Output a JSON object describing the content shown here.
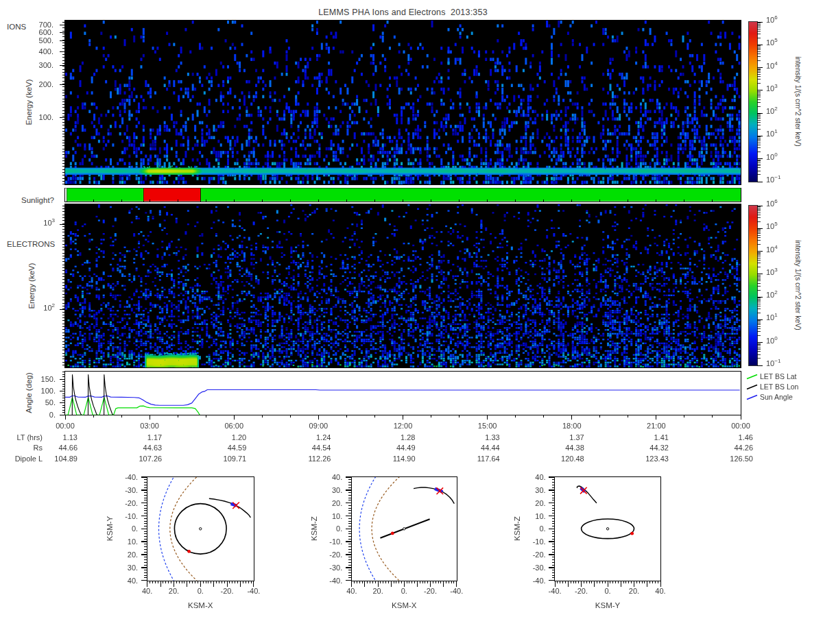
{
  "title": "LEMMS PHA Ions and Electrons  2013:353",
  "text_color": "#3c3c3c",
  "chart_data": {
    "ions": {
      "type": "heatmap",
      "label": "IONS",
      "ylabel": "Energy (keV)",
      "yscale": "log",
      "yrange_kev": [
        24.5,
        768
      ],
      "ytick_labels": [
        "700.",
        "600.",
        "500.",
        "400.",
        "300.",
        "200.",
        "100."
      ],
      "ytick_values": [
        700,
        600,
        500,
        400,
        300,
        200,
        100
      ],
      "xrange_hours": [
        0,
        24
      ],
      "background": "#000000",
      "noise": {
        "seed": 11,
        "description": "sparse blue speckle noise, density increasing toward low energy",
        "speckle_log_intensity": [
          0.2,
          1.8
        ]
      },
      "band": {
        "description": "persistent low-energy proton band",
        "energy_kev": [
          34,
          46
        ],
        "log_intensity": 0.9,
        "bright_interval_hr": [
          2.6,
          4.87
        ],
        "bright_log_intensity": 3.0
      }
    },
    "sunlight": {
      "type": "timeline",
      "label": "Sunlight?",
      "segments": [
        {
          "start_hr": 0.0,
          "end_hr": 0.06,
          "state": "no data",
          "color": "#ffffff"
        },
        {
          "start_hr": 0.06,
          "end_hr": 2.79,
          "state": "yes",
          "color": "#00e000"
        },
        {
          "start_hr": 2.79,
          "end_hr": 4.82,
          "state": "no",
          "color": "#ee0000"
        },
        {
          "start_hr": 4.82,
          "end_hr": 24.0,
          "state": "yes",
          "color": "#00e000"
        }
      ]
    },
    "electrons": {
      "type": "heatmap",
      "label": "ELECTRONS",
      "ylabel": "Energy (keV)",
      "yscale": "log",
      "yrange_kev": [
        21,
        1745
      ],
      "ytick_exponents": [
        3,
        2
      ],
      "xrange_hours": [
        0,
        24
      ],
      "background": "#000000",
      "noise": {
        "seed": 23,
        "description": "blue speckle noise, very sparse at high energy, dense with cyan/green mix at low energy",
        "speckle_log_intensity": [
          0.2,
          1.6
        ]
      },
      "blob": {
        "description": "bright low-energy electron enhancement during eclipse",
        "time_hr": [
          2.83,
          4.73
        ],
        "energy_kev": [
          18,
          27
        ],
        "core_log_intensity": 3.4
      }
    },
    "colorbar": {
      "label": "intensity 1/(s cm^2 ster keV)",
      "log_range": [
        -1,
        6
      ],
      "tick_exponents": [
        6,
        5,
        4,
        3,
        2,
        1,
        0,
        -1
      ]
    },
    "angles": {
      "type": "line",
      "ylabel": "Angle (deg)",
      "ytick_labels": [
        "150.",
        "100.",
        "50.",
        "0."
      ],
      "ytick_values": [
        150,
        100,
        50,
        0
      ],
      "yrange_deg": [
        0,
        184
      ],
      "xrange_hours": [
        0,
        24
      ],
      "legend": [
        {
          "label": "LET BS Lat",
          "color": "#00dd00"
        },
        {
          "label": "LET BS Lon",
          "color": "#000000"
        },
        {
          "label": "Sun Angle",
          "color": "#2222ee"
        }
      ],
      "series": {
        "sun_angle": [
          [
            0,
            74.5
          ],
          [
            0.16,
            74.5
          ],
          [
            0.24,
            80
          ],
          [
            0.34,
            80
          ],
          [
            0.46,
            75
          ],
          [
            0.72,
            74.5
          ],
          [
            0.8,
            79
          ],
          [
            0.92,
            80
          ],
          [
            1.04,
            75.5
          ],
          [
            1.3,
            74.5
          ],
          [
            1.37,
            79
          ],
          [
            1.5,
            80
          ],
          [
            1.62,
            75.5
          ],
          [
            2.0,
            74.5
          ],
          [
            2.45,
            73.5
          ],
          [
            2.62,
            72
          ],
          [
            2.75,
            64
          ],
          [
            2.9,
            53
          ],
          [
            3.05,
            45
          ],
          [
            3.2,
            41.5
          ],
          [
            3.35,
            40.5
          ],
          [
            4.2,
            40.5
          ],
          [
            4.35,
            43
          ],
          [
            4.5,
            50
          ],
          [
            4.62,
            68
          ],
          [
            4.75,
            88
          ],
          [
            4.87,
            97
          ],
          [
            4.95,
            99
          ],
          [
            5.05,
            106
          ],
          [
            8.9,
            106
          ],
          [
            9.05,
            104.5
          ],
          [
            23.97,
            104.5
          ]
        ],
        "let_bs_lat": [
          [
            0,
            0
          ],
          [
            0.1,
            0
          ],
          [
            0.256,
            73
          ],
          [
            0.41,
            0
          ],
          [
            0.66,
            0
          ],
          [
            0.82,
            74
          ],
          [
            0.98,
            0
          ],
          [
            1.22,
            0
          ],
          [
            1.385,
            74
          ],
          [
            1.55,
            0
          ],
          [
            1.72,
            0
          ],
          [
            1.8,
            27
          ],
          [
            1.88,
            30
          ],
          [
            2.55,
            30
          ],
          [
            2.65,
            37
          ],
          [
            2.78,
            38
          ],
          [
            2.92,
            32
          ],
          [
            3.0,
            30.5
          ],
          [
            4.5,
            30
          ],
          [
            4.62,
            27
          ],
          [
            4.72,
            12
          ],
          [
            4.78,
            0
          ]
        ],
        "let_bs_lon_spikes": [
          [
            [
              0.25,
              0
            ],
            [
              0.256,
              169
            ],
            [
              0.29,
              120
            ],
            [
              0.33,
              90
            ],
            [
              0.38,
              62
            ],
            [
              0.44,
              38
            ],
            [
              0.5,
              18
            ],
            [
              0.55,
              5
            ],
            [
              0.58,
              0
            ]
          ],
          [
            [
              0.815,
              0
            ],
            [
              0.82,
              169
            ],
            [
              0.855,
              120
            ],
            [
              0.895,
              90
            ],
            [
              0.945,
              62
            ],
            [
              1.005,
              38
            ],
            [
              1.07,
              18
            ],
            [
              1.11,
              5
            ],
            [
              1.14,
              0
            ]
          ],
          [
            [
              1.38,
              0
            ],
            [
              1.385,
              169
            ],
            [
              1.42,
              120
            ],
            [
              1.46,
              90
            ],
            [
              1.51,
              62
            ],
            [
              1.57,
              38
            ],
            [
              1.63,
              18
            ],
            [
              1.67,
              5
            ],
            [
              1.7,
              0
            ]
          ]
        ]
      }
    },
    "ephemeris": {
      "type": "table",
      "time_tick_labels": [
        "00:00",
        "03:00",
        "06:00",
        "09:00",
        "12:00",
        "15:00",
        "18:00",
        "21:00",
        "00:00"
      ],
      "rows": [
        {
          "label": "LT (hrs)",
          "values": [
            "1.13",
            "1.17",
            "1.20",
            "1.24",
            "1.28",
            "1.33",
            "1.37",
            "1.41",
            "1.46"
          ]
        },
        {
          "label": "Rs",
          "values": [
            "44.66",
            "44.63",
            "44.59",
            "44.54",
            "44.49",
            "44.44",
            "44.38",
            "44.32",
            "44.26"
          ]
        },
        {
          "label": "Dipole L",
          "values": [
            "104.89",
            "107.26",
            "109.71",
            "112.26",
            "114.90",
            "117.64",
            "120.48",
            "123.43",
            "126.50"
          ]
        }
      ]
    },
    "orbits": {
      "xy": {
        "type": "scatter",
        "xlabel": "KSM-X",
        "ylabel": "KSM-Y",
        "xtick_labels": [
          "40.",
          "20.",
          "0.",
          "-20.",
          "-40."
        ],
        "xtick_values": [
          40,
          20,
          0,
          -20,
          -40
        ],
        "ytick_labels": [
          "-40.",
          "-30.",
          "-20.",
          "-10.",
          "0.",
          "10.",
          "20.",
          "30.",
          "40."
        ],
        "ytick_values": [
          -40,
          -30,
          -20,
          -10,
          0,
          10,
          20,
          30,
          40
        ],
        "x_left_value": 40,
        "x_right_value": -40,
        "y_top_value": -40,
        "y_bottom_value": 40,
        "bow_shock": {
          "apex_x": 31.3,
          "coef": 0.007,
          "color": "#2244ee"
        },
        "magnetopause": {
          "apex_x": 22.9,
          "coef": 0.0125,
          "color": "#96591e"
        },
        "titan_orbit_circle": {
          "cx": 0,
          "cy": 0,
          "r": 19.5
        },
        "saturn": {
          "x": 0,
          "y": 0
        },
        "titan_dot": {
          "x": 8.6,
          "y": 17.5,
          "color": "#ee0000"
        },
        "trajectory": [
          [
            -6.5,
            -23.4
          ],
          [
            -10,
            -23.0
          ],
          [
            -14,
            -22.3
          ],
          [
            -18,
            -21.4
          ],
          [
            -22,
            -20.2
          ],
          [
            -26,
            -18.5
          ],
          [
            -29.5,
            -16.5
          ],
          [
            -32.5,
            -14.2
          ],
          [
            -34.8,
            -12.2
          ],
          [
            -36.5,
            -10.5
          ],
          [
            -37.7,
            -8.7
          ]
        ],
        "coverage_segment": [
          [
            -22.9,
            -19.4
          ],
          [
            -27.2,
            -17.9
          ]
        ],
        "position_marker": {
          "x": -26.7,
          "y": -18.1,
          "color": "#ee0000"
        }
      },
      "xz": {
        "type": "scatter",
        "xlabel": "KSM-X",
        "ylabel": "KSM-Z",
        "xtick_labels": [
          "40.",
          "20.",
          "0.",
          "-20.",
          "-40."
        ],
        "xtick_values": [
          40,
          20,
          0,
          -20,
          -40
        ],
        "ytick_labels": [
          "40.",
          "30.",
          "20.",
          "10.",
          "0.",
          "-10.",
          "-20.",
          "-30.",
          "-40."
        ],
        "ytick_values": [
          40,
          30,
          20,
          10,
          0,
          -10,
          -20,
          -30,
          -40
        ],
        "x_left_value": 40,
        "x_right_value": -40,
        "y_top_value": 40,
        "y_bottom_value": -40,
        "bow_shock": {
          "apex_x": 34.1,
          "coef": 0.0076,
          "color": "#2244ee"
        },
        "magnetopause": {
          "apex_x": 24.7,
          "coef": 0.013,
          "color": "#96591e"
        },
        "titan_orbit_line": [
          [
            18.2,
            -7.1
          ],
          [
            -19.5,
            7.5
          ]
        ],
        "saturn": {
          "x": 0,
          "y": 0
        },
        "titan_dot": {
          "x": 8.9,
          "y": -3.5,
          "color": "#ee0000"
        },
        "trajectory": [
          [
            -7.2,
            31.2
          ],
          [
            -10,
            31.7
          ],
          [
            -13,
            32.0
          ],
          [
            -16,
            32.0
          ],
          [
            -19,
            31.7
          ],
          [
            -22,
            31.2
          ],
          [
            -25,
            30.4
          ],
          [
            -27.5,
            29.5
          ],
          [
            -30,
            28.2
          ],
          [
            -32.5,
            26.5
          ],
          [
            -34.7,
            24.5
          ],
          [
            -36.6,
            22.2
          ],
          [
            -38.2,
            19.5
          ]
        ],
        "coverage_segment": [
          [
            -23.4,
            31.0
          ],
          [
            -29.3,
            28.7
          ]
        ],
        "position_marker": {
          "x": -27.2,
          "y": 29.3,
          "color": "#ee0000"
        }
      },
      "yz": {
        "type": "scatter",
        "xlabel": "KSM-Y",
        "ylabel": "KSM-Z",
        "xtick_labels": [
          "-40.",
          "-20.",
          "0.",
          "20.",
          "40."
        ],
        "xtick_values": [
          -40,
          -20,
          0,
          20,
          40
        ],
        "ytick_labels": [
          "40.",
          "30.",
          "20.",
          "10.",
          "0.",
          "-10.",
          "-20.",
          "-30.",
          "-40."
        ],
        "ytick_values": [
          40,
          30,
          20,
          10,
          0,
          -10,
          -20,
          -30,
          -40
        ],
        "x_left_value": -40,
        "x_right_value": 40,
        "y_top_value": 40,
        "y_bottom_value": -40,
        "titan_orbit_ellipse": {
          "cx": 0,
          "cy": 0,
          "rx": 20,
          "ry": 7.6
        },
        "saturn": {
          "x": 0,
          "y": 0
        },
        "titan_dot": {
          "x": 18.5,
          "y": -3.6,
          "color": "#ee0000"
        },
        "trajectory": [
          [
            -23.1,
            31.5
          ],
          [
            -23.2,
            32.4
          ],
          [
            -22.5,
            33.0
          ],
          [
            -21.4,
            33.1
          ],
          [
            -20.1,
            32.5
          ],
          [
            -18.5,
            31.3
          ],
          [
            -16.8,
            29.7
          ],
          [
            -14.8,
            27.6
          ],
          [
            -12.8,
            25.2
          ],
          [
            -10.8,
            22.7
          ],
          [
            -9.2,
            20.9
          ],
          [
            -8.4,
            19.9
          ]
        ],
        "coverage_segment": [
          [
            -20.4,
            31.6
          ],
          [
            -17.3,
            28.6
          ]
        ],
        "position_marker": {
          "x": -18.3,
          "y": 29.6,
          "color": "#ee0000"
        }
      }
    }
  }
}
